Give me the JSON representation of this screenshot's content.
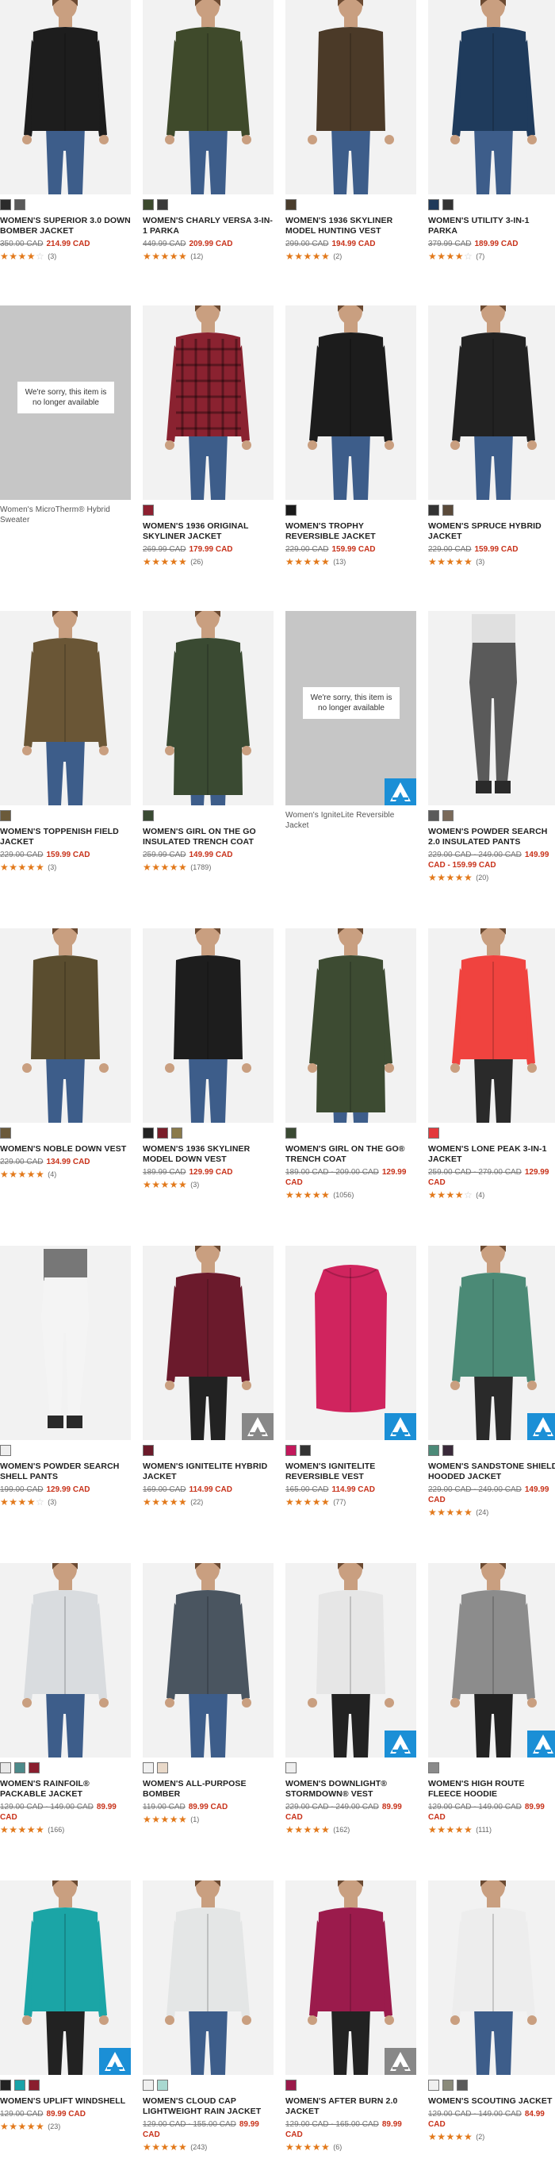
{
  "sorry_text": "We're sorry, this item is no longer available",
  "products": [
    {
      "name": "Women's Superior 3.0 Down Bomber Jacket",
      "old": "350.00 CAD",
      "sale": "214.99 CAD",
      "rating": 3.5,
      "count": "(3)",
      "swatches": [
        "#2b2b2b",
        "#5a5a5a"
      ],
      "color": "#1d1d1d",
      "pants": "#3d5d8a",
      "skin": "#c99f80"
    },
    {
      "name": "Women's Charly Versa 3-in-1 Parka",
      "old": "449.99 CAD",
      "sale": "209.99 CAD",
      "rating": 4.5,
      "count": "(12)",
      "swatches": [
        "#3c4a2e",
        "#3a3a3a"
      ],
      "color": "#3f4a2b",
      "pants": "#3d5d8a",
      "skin": "#c99f80"
    },
    {
      "name": "Women's 1936 Skyliner Model Hunting Vest",
      "old": "299.00 CAD",
      "sale": "194.99 CAD",
      "rating": 5,
      "count": "(2)",
      "swatches": [
        "#4a3d2d"
      ],
      "color": "#4b3a28",
      "pants": "#3d5d8a",
      "skin": "#c99f80",
      "vest": true
    },
    {
      "name": "Women's Utility 3-in-1 Parka",
      "old": "379.99 CAD",
      "sale": "189.99 CAD",
      "rating": 3.5,
      "count": "(7)",
      "swatches": [
        "#1f3a5a",
        "#333"
      ],
      "color": "#1f3b5c",
      "pants": "#3d5d8a",
      "skin": "#c99f80"
    },
    {
      "name": "Women's MicroTherm® Hybrid Sweater",
      "unavailable": true
    },
    {
      "name": "Women's 1936 Original Skyliner Jacket",
      "old": "269.99 CAD",
      "sale": "179.99 CAD",
      "rating": 4.5,
      "count": "(26)",
      "swatches": [
        "#8e2030"
      ],
      "color": "#8a2230",
      "pants": "#3d5d8a",
      "skin": "#c99f80",
      "plaid": true
    },
    {
      "name": "Women's Trophy Reversible Jacket",
      "old": "229.00 CAD",
      "sale": "159.99 CAD",
      "rating": 4.5,
      "count": "(13)",
      "swatches": [
        "#1a1a1a"
      ],
      "color": "#1c1c1c",
      "pants": "#3d5d8a",
      "skin": "#c99f80"
    },
    {
      "name": "Women's Spruce Hybrid Jacket",
      "old": "229.00 CAD",
      "sale": "159.99 CAD",
      "rating": 5,
      "count": "(3)",
      "swatches": [
        "#333",
        "#5a4a3a"
      ],
      "color": "#222",
      "pants": "#3d5d8a",
      "skin": "#c99f80"
    },
    {
      "name": "Women's Toppenish Field Jacket",
      "old": "229.00 CAD",
      "sale": "159.99 CAD",
      "rating": 5,
      "count": "(3)",
      "swatches": [
        "#6b5a3a"
      ],
      "color": "#6a5636",
      "pants": "#3d5d8a",
      "skin": "#c99f80"
    },
    {
      "name": "Women's Girl on the Go Insulated Trench Coat",
      "old": "259.99 CAD",
      "sale": "149.99 CAD",
      "rating": 4.5,
      "count": "(1789)",
      "swatches": [
        "#3a4a33"
      ],
      "color": "#3a4a32",
      "pants": "#3d5d8a",
      "skin": "#c99f80",
      "long": true
    },
    {
      "name": "Women's IgniteLite Reversible Jacket",
      "unavailable": true,
      "badge": true
    },
    {
      "name": "Women's Powder Search 2.0 Insulated Pants",
      "old": "229.00 CAD",
      "old2": "249.00 CAD",
      "sale": "149.99 CAD",
      "sale2": "159.99 CAD",
      "rating": 4.5,
      "count": "(20)",
      "swatches": [
        "#5a5a5a",
        "#7a6a5a"
      ],
      "color": "#e0e0e0",
      "pants": "#5a5a5a",
      "skin": "#c99f80",
      "pantsOnly": true
    },
    {
      "name": "Women's Noble Down Vest",
      "old": "229.00 CAD",
      "sale": "134.99 CAD",
      "rating": 4.5,
      "count": "(4)",
      "swatches": [
        "#6b5a3a"
      ],
      "color": "#5a4d2f",
      "pants": "#3d5d8a",
      "skin": "#c99f80",
      "vest": true
    },
    {
      "name": "Women's 1936 Skyliner Model Down Vest",
      "old": "189.99 CAD",
      "sale": "129.99 CAD",
      "rating": 5,
      "count": "(3)",
      "swatches": [
        "#222",
        "#7a1e2a",
        "#8a7a4a"
      ],
      "color": "#1d1d1d",
      "pants": "#3d5d8a",
      "skin": "#c99f80",
      "vest": true
    },
    {
      "name": "Women's Girl on the Go® Trench Coat",
      "old": "189.00 CAD",
      "old2": "209.00 CAD",
      "sale": "129.99 CAD",
      "rating": 4.5,
      "count": "(1056)",
      "swatches": [
        "#3a4a33"
      ],
      "color": "#3d4b32",
      "pants": "#3d5d8a",
      "skin": "#c99f80",
      "long": true
    },
    {
      "name": "Women's Lone Peak 3-in-1 Jacket",
      "old": "259.00 CAD",
      "old2": "279.00 CAD",
      "sale": "129.99 CAD",
      "rating": 3.5,
      "count": "(4)",
      "swatches": [
        "#e3393c"
      ],
      "color": "#f0433f",
      "pants": "#2a2a2a",
      "skin": "#c99f80"
    },
    {
      "name": "Women's Powder Search Shell Pants",
      "old": "199.00 CAD",
      "sale": "129.99 CAD",
      "rating": 3.5,
      "count": "(3)",
      "swatches": [
        "#eeeeee"
      ],
      "color": "#777",
      "pants": "#f4f4f4",
      "skin": "#c99f80",
      "pantsOnly": true
    },
    {
      "name": "Women's IgniteLite Hybrid Jacket",
      "old": "169.00 CAD",
      "sale": "114.99 CAD",
      "rating": 4.5,
      "count": "(22)",
      "swatches": [
        "#6b1a2a"
      ],
      "color": "#6b1a2c",
      "pants": "#222",
      "skin": "#c99f80",
      "badge": true,
      "badgeGray": true
    },
    {
      "name": "Women's IgniteLite Reversible Vest",
      "old": "165.00 CAD",
      "sale": "114.99 CAD",
      "rating": 4.5,
      "count": "(77)",
      "swatches": [
        "#c2185b",
        "#333"
      ],
      "color": "#d0245e",
      "pants": "#3d5d8a",
      "skin": "#c99f80",
      "vest": true,
      "badge": true,
      "noPerson": true
    },
    {
      "name": "Women's Sandstone Shield Hooded Jacket",
      "old": "229.00 CAD",
      "old2": "249.00 CAD",
      "sale": "149.99 CAD",
      "rating": 4.5,
      "count": "(24)",
      "swatches": [
        "#4c8a78",
        "#3a2a3a"
      ],
      "color": "#4b8a76",
      "pants": "#2a2a2a",
      "skin": "#c99f80",
      "badge": true
    },
    {
      "name": "Women's Rainfoil® Packable Jacket",
      "old": "129.00 CAD",
      "old2": "149.00 CAD",
      "sale": "89.99 CAD",
      "rating": 4.5,
      "count": "(166)",
      "swatches": [
        "#e8e8e8",
        "#4c8a8a",
        "#8a1e2e"
      ],
      "color": "#d9dcdf",
      "pants": "#3d5d8a",
      "skin": "#c99f80"
    },
    {
      "name": "Women's All-Purpose Bomber",
      "old": "119.00 CAD",
      "sale": "89.99 CAD",
      "rating": 5,
      "count": "(1)",
      "swatches": [
        "#f0f0f0",
        "#e8d8c8"
      ],
      "color": "#4a5560",
      "pants": "#3d5d8a",
      "skin": "#c99f80"
    },
    {
      "name": "Women's Downlight® StormDown® Vest",
      "old": "229.00 CAD",
      "old2": "249.00 CAD",
      "sale": "89.99 CAD",
      "rating": 4.5,
      "count": "(162)",
      "swatches": [
        "#eeeeee"
      ],
      "color": "#e6e6e6",
      "pants": "#222",
      "skin": "#c99f80",
      "vest": true,
      "badge": true
    },
    {
      "name": "Women's High Route Fleece Hoodie",
      "old": "129.00 CAD",
      "old2": "149.00 CAD",
      "sale": "89.99 CAD",
      "rating": 4.5,
      "count": "(111)",
      "swatches": [
        "#8a8a8a"
      ],
      "color": "#8c8c8c",
      "pants": "#222",
      "skin": "#c99f80",
      "badge": true
    },
    {
      "name": "Women's Uplift Windshell",
      "old": "129.00 CAD",
      "sale": "89.99 CAD",
      "rating": 4.5,
      "count": "(23)",
      "swatches": [
        "#222",
        "#1aa3a8",
        "#8a1e2e"
      ],
      "color": "#1ba5a6",
      "pants": "#222",
      "skin": "#c99f80",
      "badge": true
    },
    {
      "name": "Women's Cloud Cap Lightweight Rain Jacket",
      "old": "129.00 CAD",
      "old2": "155.00 CAD",
      "sale": "89.99 CAD",
      "rating": 4.5,
      "count": "(243)",
      "swatches": [
        "#f0f0f0",
        "#a8d8d0"
      ],
      "color": "#e4e6e6",
      "pants": "#3d5d8a",
      "skin": "#c99f80"
    },
    {
      "name": "Women's After Burn 2.0 Jacket",
      "old": "129.00 CAD",
      "old2": "165.00 CAD",
      "sale": "89.99 CAD",
      "rating": 5,
      "count": "(6)",
      "swatches": [
        "#9a1a4a"
      ],
      "color": "#9b1b4c",
      "pants": "#222",
      "skin": "#c99f80",
      "badge": true,
      "badgeGray": true
    },
    {
      "name": "Women's Scouting Jacket",
      "old": "129.00 CAD",
      "old2": "149.00 CAD",
      "sale": "84.99 CAD",
      "rating": 5,
      "count": "(2)",
      "swatches": [
        "#f0f0f0",
        "#8a8a7a",
        "#5a5a5a"
      ],
      "color": "#ededed",
      "pants": "#3d5d8a",
      "skin": "#c99f80"
    }
  ]
}
